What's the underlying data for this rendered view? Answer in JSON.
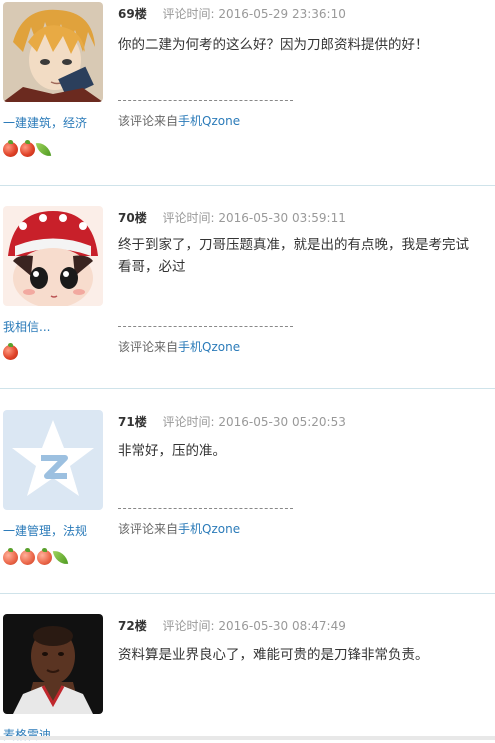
{
  "comments": [
    {
      "floor": "69楼",
      "time_label": "评论时间: 2016-05-29 23:36:10",
      "content": "你的二建为何考的这么好？因为刀郎资料提供的好！",
      "username": "一建建筑，经济",
      "badges": [
        "fruit",
        "fruit",
        "leaf"
      ],
      "avatar": "anime-avatar",
      "source_prefix": "该评论来自",
      "source_link": "手机Qzone"
    },
    {
      "floor": "70楼",
      "time_label": "评论时间: 2016-05-30 03:59:11",
      "content": "终于到家了，刀哥压题真准，就是出的有点晚，我是考完试看哥，必过",
      "username": "我相信...",
      "badges": [
        "fruit"
      ],
      "avatar": "doll-avatar",
      "source_prefix": "该评论来自",
      "source_link": "手机Qzone"
    },
    {
      "floor": "71楼",
      "time_label": "评论时间: 2016-05-30 05:20:53",
      "content": "非常好，压的准。",
      "username": "一建管理，法规",
      "badges": [
        "fruit",
        "fruit",
        "fruit",
        "leaf"
      ],
      "avatar": "qzone-default-avatar",
      "source_prefix": "该评论来自",
      "source_link": "手机Qzone"
    },
    {
      "floor": "72楼",
      "time_label": "评论时间: 2016-05-30 08:47:49",
      "content": "资料算是业界良心了，难能可贵的是刀锋非常负责。",
      "username": "麦格雷迪",
      "avatar": "player-avatar"
    }
  ]
}
